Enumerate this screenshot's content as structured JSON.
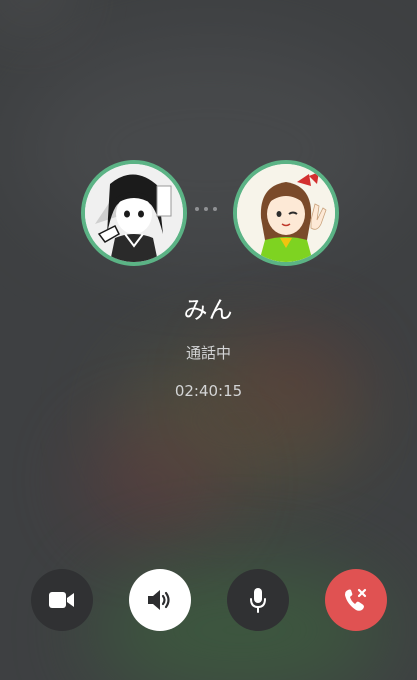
{
  "call": {
    "contact_name": "みん",
    "status": "通話中",
    "duration": "02:40:15"
  },
  "controls": [
    {
      "icon": "video-camera-icon",
      "active": false
    },
    {
      "icon": "speaker-icon",
      "active": true
    },
    {
      "icon": "microphone-icon",
      "active": false
    },
    {
      "icon": "end-call-icon",
      "active": false
    }
  ],
  "colors": {
    "avatar_ring": "#5bb385",
    "end_call": "#e05252",
    "control_bg": "#303133",
    "active_control_bg": "#ffffff"
  }
}
